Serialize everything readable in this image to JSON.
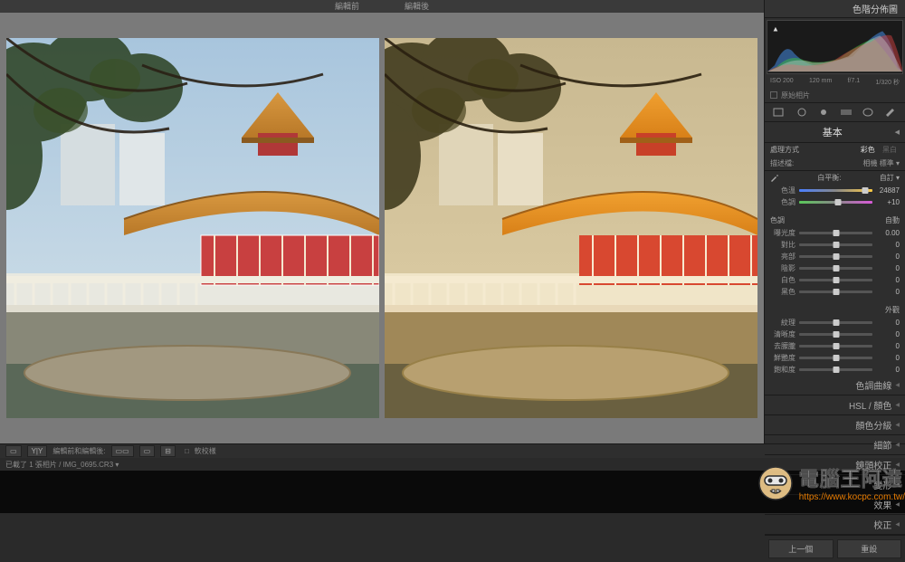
{
  "sidebar_title": "色階分佈圖",
  "view_labels": {
    "before": "編輯前",
    "after": "編輯後"
  },
  "histogram_info": {
    "iso": "ISO 200",
    "lens": "120 mm",
    "aperture": "f/7.1",
    "shutter": "1/320 秒"
  },
  "original_photo": "原始相片",
  "panels": {
    "basic": {
      "title": "基本",
      "treatment_label": "處理方式",
      "treatment_color": "彩色",
      "treatment_bw": "黑白",
      "profile_label": "描述檔:",
      "profile_value": "相機 標準",
      "wb": {
        "label": "白平衡:",
        "preset": "自訂",
        "temp_label": "色溫",
        "temp_value": "24887",
        "tint_label": "色調",
        "tint_value": "+10"
      },
      "tone": {
        "section": "色調",
        "auto": "自動",
        "exposure": {
          "label": "曝光度",
          "value": "0.00"
        },
        "contrast": {
          "label": "對比",
          "value": "0"
        },
        "highlights": {
          "label": "亮部",
          "value": "0"
        },
        "shadows": {
          "label": "陰影",
          "value": "0"
        },
        "whites": {
          "label": "白色",
          "value": "0"
        },
        "blacks": {
          "label": "黑色",
          "value": "0"
        }
      },
      "presence": {
        "section": "外觀",
        "texture": {
          "label": "紋理",
          "value": "0"
        },
        "clarity": {
          "label": "清晰度",
          "value": "0"
        },
        "dehaze": {
          "label": "去朦朧",
          "value": "0"
        },
        "vibrance": {
          "label": "鮮艷度",
          "value": "0"
        },
        "saturation": {
          "label": "飽和度",
          "value": "0"
        }
      }
    },
    "collapsed": [
      "色調曲線",
      "HSL / 顏色",
      "顏色分級",
      "細節",
      "鏡頭校正",
      "變形",
      "效果",
      "校正"
    ]
  },
  "sidebar_buttons": {
    "prev": "上一個",
    "reset": "重設"
  },
  "toolbar": {
    "compare": "編輯前和編輯後:",
    "soft_proof": "軟校樣"
  },
  "status": {
    "loaded": "已載了",
    "count": "1 張相片",
    "file": "IMG_0695.CR3"
  },
  "watermark": {
    "title": "電腦王阿達",
    "url": "https://www.kocpc.com.tw/"
  }
}
